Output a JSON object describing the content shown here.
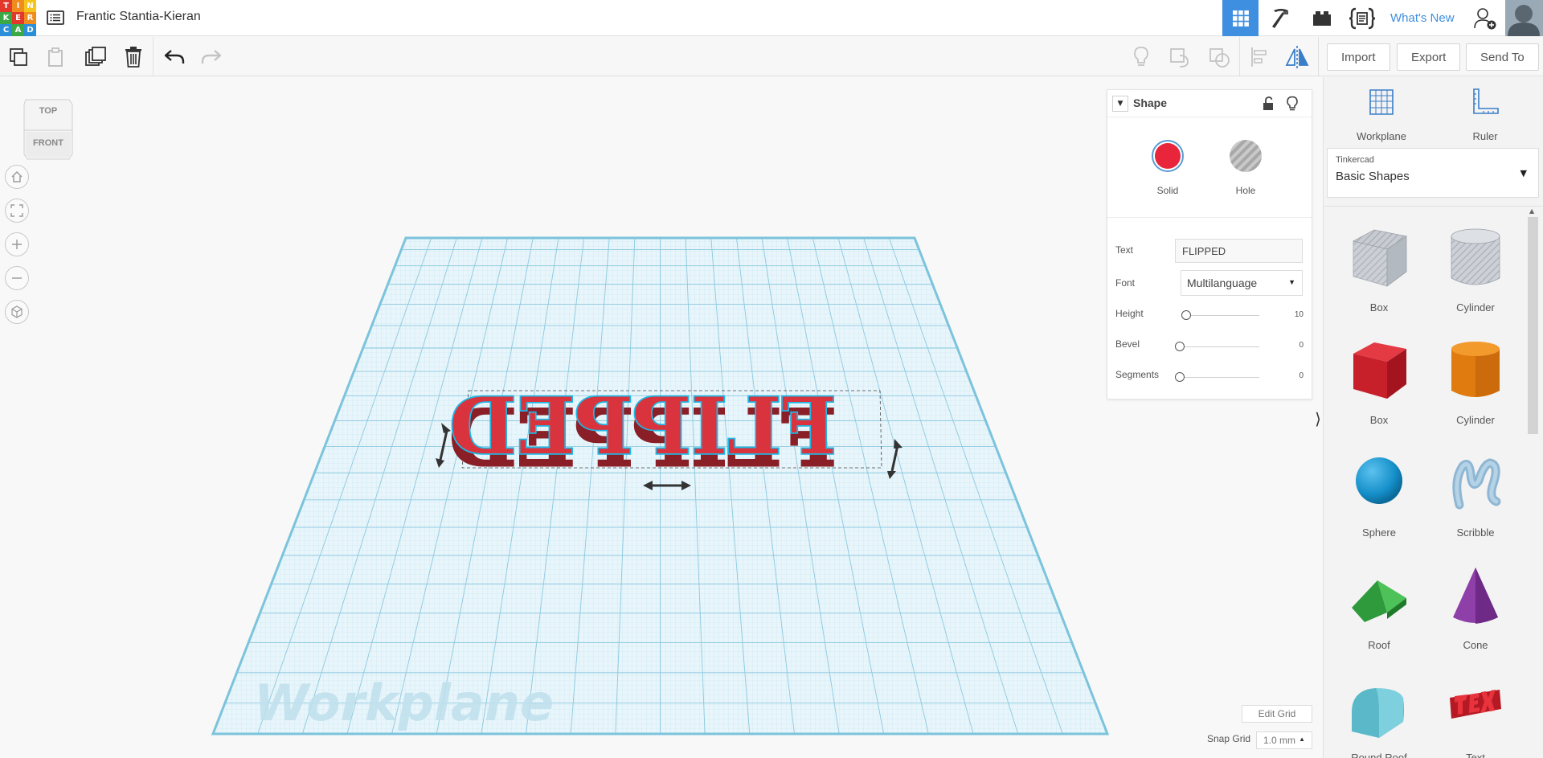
{
  "app": {
    "logo_letters": [
      "T",
      "I",
      "N",
      "K",
      "E",
      "R",
      "C",
      "A",
      "D"
    ],
    "logo_colors": [
      "#e2372b",
      "#f08b1e",
      "#f6c51c",
      "#3aa845",
      "#e2372b",
      "#f08b1e",
      "#2b8ed8",
      "#3aa845",
      "#2b8ed8"
    ],
    "project_title": "Frantic Stantia-Kieran"
  },
  "header": {
    "whats_new": "What's New"
  },
  "toolbar": {
    "import_label": "Import",
    "export_label": "Export",
    "sendto_label": "Send To"
  },
  "viewcube": {
    "top": "TOP",
    "front": "FRONT"
  },
  "scene": {
    "workplane_watermark": "Workplane",
    "text_object": "FLIPPED",
    "object_color": "#d9343e",
    "outline_color": "#1fb8e6",
    "grid_color": "#a9d8ea"
  },
  "inspector": {
    "title": "Shape",
    "solid_label": "Solid",
    "hole_label": "Hole",
    "solid_color": "#e8253a",
    "text_label": "Text",
    "text_value": "FLIPPED",
    "font_label": "Font",
    "font_value": "Multilanguage",
    "height_label": "Height",
    "height_value": "10",
    "bevel_label": "Bevel",
    "bevel_value": "0",
    "segments_label": "Segments",
    "segments_value": "0"
  },
  "grid": {
    "edit_grid": "Edit Grid",
    "snap_label": "Snap Grid",
    "snap_value": "1.0 mm"
  },
  "rightpanel": {
    "workplane_label": "Workplane",
    "ruler_label": "Ruler",
    "library_category": "Tinkercad",
    "library_name": "Basic Shapes",
    "shapes": [
      {
        "label": "Box"
      },
      {
        "label": "Cylinder"
      },
      {
        "label": "Box"
      },
      {
        "label": "Cylinder"
      },
      {
        "label": "Sphere"
      },
      {
        "label": "Scribble"
      },
      {
        "label": "Roof"
      },
      {
        "label": "Cone"
      },
      {
        "label": "Round Roof"
      },
      {
        "label": "Text"
      }
    ]
  }
}
